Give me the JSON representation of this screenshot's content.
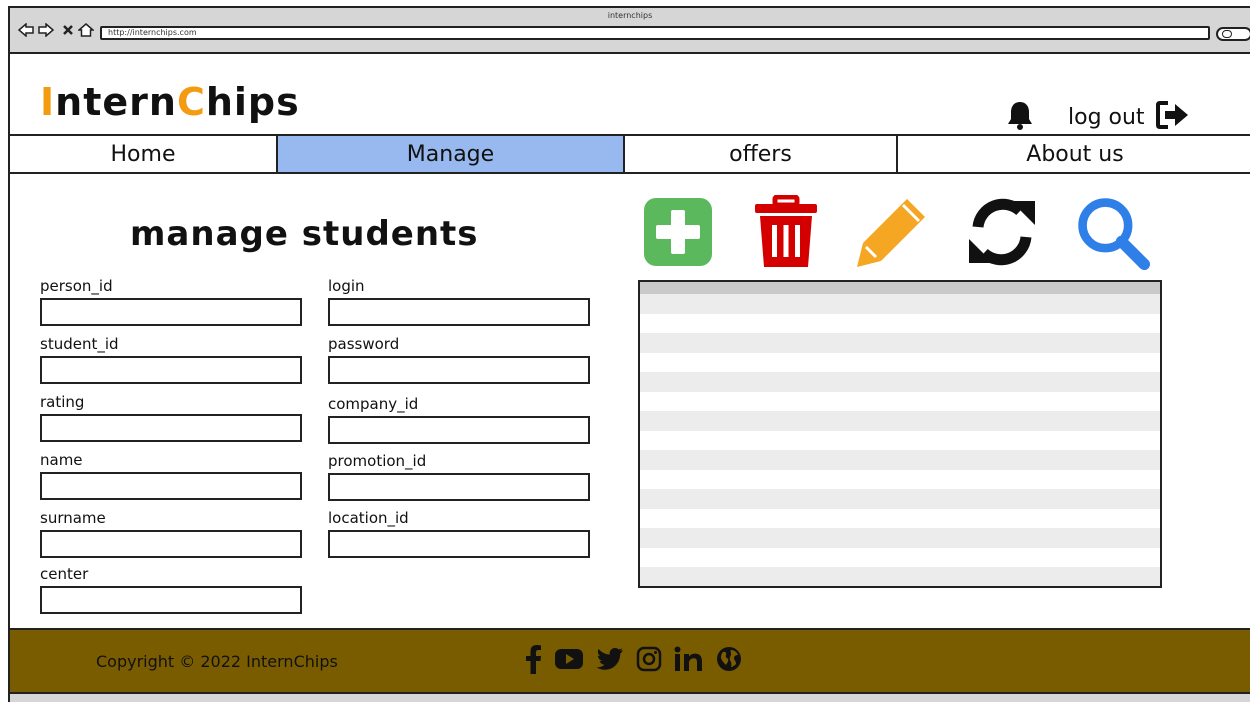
{
  "browser": {
    "title": "internchips",
    "url": "http://internchips.com"
  },
  "header": {
    "logo_start": "I",
    "logo_part1": "ntern",
    "logo_c": "C",
    "logo_part2": "hips",
    "logout_label": "log out"
  },
  "nav": {
    "items": [
      {
        "label": "Home"
      },
      {
        "label": "Manage"
      },
      {
        "label": "offers"
      },
      {
        "label": "About us"
      }
    ],
    "active": "Manage"
  },
  "main": {
    "title": "manage students",
    "fields_left": [
      {
        "label": "person_id",
        "value": ""
      },
      {
        "label": "student_id",
        "value": ""
      },
      {
        "label": "rating",
        "value": ""
      },
      {
        "label": "name",
        "value": ""
      },
      {
        "label": "surname",
        "value": ""
      },
      {
        "label": "center",
        "value": ""
      }
    ],
    "fields_right": [
      {
        "label": "login",
        "value": ""
      },
      {
        "label": "password",
        "value": ""
      },
      {
        "label": "company_id",
        "value": ""
      },
      {
        "label": "promotion_id",
        "value": ""
      },
      {
        "label": "location_id",
        "value": ""
      }
    ],
    "toolbar": [
      {
        "name": "add-icon",
        "color": "#5cb85c"
      },
      {
        "name": "trash-icon",
        "color": "#d40000"
      },
      {
        "name": "pencil-icon",
        "color": "#f5a623"
      },
      {
        "name": "refresh-icon",
        "color": "#111111"
      },
      {
        "name": "search-icon",
        "color": "#2f7fe8"
      }
    ]
  },
  "footer": {
    "copyright": "Copyright © 2022 InternChips",
    "socials": [
      "facebook-icon",
      "youtube-icon",
      "twitter-icon",
      "instagram-icon",
      "linkedin-icon",
      "globe-icon"
    ]
  },
  "colors": {
    "accent": "#f39c12",
    "nav_active": "#98b9ef",
    "footer_bg": "#7a5c00"
  }
}
